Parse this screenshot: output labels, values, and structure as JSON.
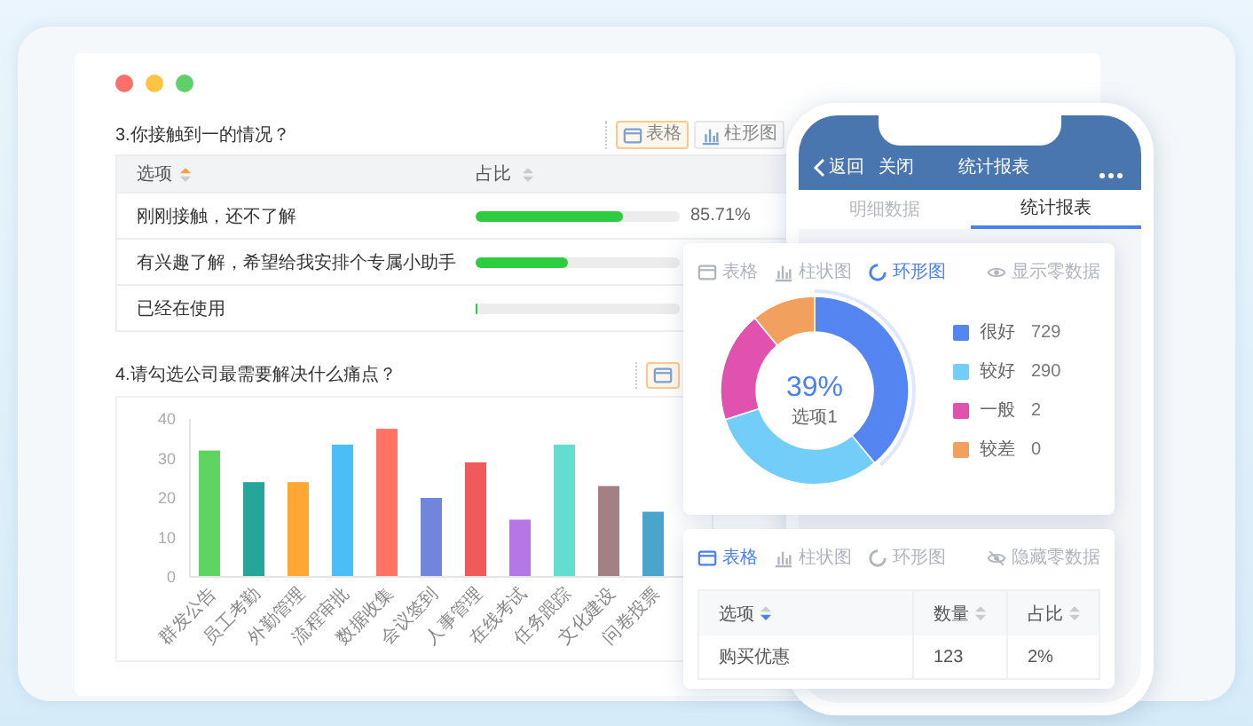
{
  "desktop": {
    "questions": [
      {
        "kind": "table",
        "title": "3.你接触到一的情况？",
        "toolbar": [
          {
            "kind": "table",
            "label": "表格",
            "selected": true
          },
          {
            "kind": "bar",
            "label": "柱形图",
            "selected": false
          }
        ],
        "columns": [
          {
            "label": "选项",
            "sort_up": true,
            "sort_down": false
          },
          {
            "label": "占比",
            "sort_up": false,
            "sort_down": false
          }
        ],
        "rows": [
          {
            "option": "刚刚接触，还不了解",
            "level": 0.72,
            "percent": "85.71%"
          },
          {
            "option": "有兴趣了解，希望给我安排个专属小助手",
            "level": 0.45
          },
          {
            "option": "已经在使用",
            "level": 0
          }
        ]
      },
      {
        "kind": "chart",
        "title": "4.请勾选公司最需要解决什么痛点？",
        "toolbar": [
          {
            "kind": "table",
            "selected": true
          }
        ],
        "chart_data": {
          "type": "bar",
          "categories": [
            "群发公告",
            "员工考勤",
            "外勤管理",
            "流程审批",
            "数据收集",
            "会议签到",
            "人事管理",
            "在线考试",
            "任务跟踪",
            "文化建设",
            "问卷投票"
          ],
          "values": [
            32,
            24,
            24,
            33.5,
            37.5,
            20,
            29,
            14.5,
            33.5,
            23,
            16.5
          ],
          "ylim": [
            0,
            40
          ],
          "yticks": [
            0,
            10,
            20,
            30,
            40
          ]
        }
      }
    ]
  },
  "phone": {
    "back": "返回",
    "close": "关闭",
    "title": "统计报表",
    "tabs": [
      {
        "label": "明细数据",
        "selected": false
      },
      {
        "label": "统计报表",
        "selected": true
      }
    ]
  },
  "donut_card": {
    "tabs": [
      {
        "kind": "table",
        "label": "表格",
        "selected": false
      },
      {
        "kind": "bar",
        "label": "柱状图",
        "selected": false
      },
      {
        "kind": "ring",
        "label": "环形图",
        "selected": true
      }
    ],
    "zero_toggle": {
      "kind": "show",
      "label": "显示零数据"
    },
    "center_value": "39%",
    "center_label": "选项1",
    "legend": [
      {
        "label": "很好",
        "count": "729",
        "color": "#5585f0"
      },
      {
        "label": "较好",
        "count": "290",
        "color": "#72cdf8"
      },
      {
        "label": "一般",
        "count": "2",
        "color": "#e052ad"
      },
      {
        "label": "较差",
        "count": "0",
        "color": "#f2a05e"
      }
    ]
  },
  "table_card": {
    "tabs": [
      {
        "kind": "table",
        "label": "表格",
        "selected": true
      },
      {
        "kind": "bar",
        "label": "柱状图",
        "selected": false
      },
      {
        "kind": "ring",
        "label": "环形图",
        "selected": false
      }
    ],
    "zero_toggle": {
      "kind": "hide",
      "label": "隐藏零数据"
    },
    "columns": [
      {
        "label": "选项",
        "sort_up": false,
        "sort_down": true
      },
      {
        "label": "数量",
        "sort_up": false,
        "sort_down": false
      },
      {
        "label": "占比",
        "sort_up": false,
        "sort_down": false
      }
    ],
    "rows": [
      [
        "购买优惠",
        "123",
        "2%"
      ]
    ]
  }
}
